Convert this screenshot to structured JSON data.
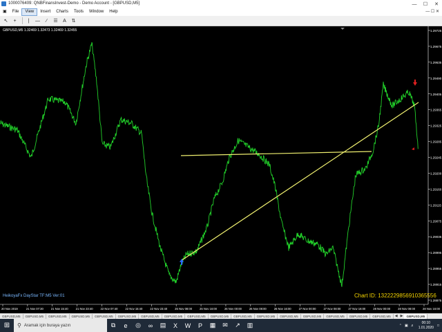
{
  "window": {
    "title": "1000076409: QNBFinansInvest-Demo - Demo Account - [GBPUSD,M5]",
    "minimize_icon": "minimize-icon",
    "maximize_icon": "maximize-icon",
    "close_icon": "close-icon"
  },
  "menu": {
    "items": [
      "File",
      "View",
      "Insert",
      "Charts",
      "Tools",
      "Window",
      "Help"
    ],
    "active_index": 1
  },
  "toolbar": {
    "icons": [
      "cursor-icon",
      "crosshair-icon",
      "vertical-line-icon",
      "horizontal-line-icon",
      "trendline-icon",
      "channel-icon",
      "text-icon",
      "arrows-icon"
    ]
  },
  "chart": {
    "symbol_info": "GBPUSD,M5  1.32469 1.32473 1.32469 1.32455",
    "indicator_label": "HeikoyaFx DayStar TF:M5 Ver:01",
    "chart_id": "Chart ID: 1322229856910365556",
    "price_labels": [
      "1.29725",
      "1.29675",
      "1.29635",
      "1.29490",
      "1.29405",
      "1.29365",
      "1.29325",
      "1.29285",
      "1.29245",
      "1.29200",
      "1.29160",
      "1.29115",
      "1.29075",
      "1.29035",
      "1.28995",
      "1.28955",
      "1.28915",
      "1.28875"
    ],
    "time_labels": [
      "20 Nov 2019",
      "21 Nov 07:30",
      "21 Nov 15:40",
      "21 Nov 23:40",
      "22 Nov 07:40",
      "22 Nov 15:40",
      "22 Nov 23:40",
      "25 Nov 08:00",
      "25 Nov 16:00",
      "26 Nov 00:00",
      "26 Nov 08:00",
      "26 Nov 16:00",
      "27 Nov 00:00",
      "27 Nov 08:00",
      "27 Nov 16:00",
      "28 Nov 00:00",
      "28 Nov 08:00",
      "28 Nov 16:00"
    ],
    "colors": {
      "price_line": "#22d12a",
      "trend_line": "#f0f070",
      "buy_arrow": "#2a6bff",
      "sell_arrow": "#e02020"
    }
  },
  "tabs": {
    "items": [
      "GBPUSD,M5",
      "GBPUSD,M5",
      "GBPUSD,M5",
      "GBPUSD,M5",
      "GBPUSD,M5",
      "GBPUSD,M5",
      "GBPUSD,M5",
      "GBPUSD,M5",
      "GBPUSD,M5",
      "GBPUSD,M5",
      "GBPUSD,M5",
      "GBPUSD,M5",
      "GBPUSD,M5",
      "GBPUSD,M5",
      "GBPUSD,M5",
      "GBPUSD,M5",
      "GBPUSD,M5"
    ],
    "active_label": "GBPUSD,M5"
  },
  "taskbar": {
    "search_placeholder": "Aramak için buraya yazın",
    "apps": [
      "task-view-icon",
      "edge-icon",
      "chrome-icon",
      "visual-studio-icon",
      "file-explorer-icon",
      "excel-icon",
      "word-icon",
      "powerpoint-icon",
      "store-icon",
      "mail-icon",
      "metatrader-icon",
      "folder-icon"
    ],
    "time": "00:10",
    "date": "1.01.2020"
  }
}
